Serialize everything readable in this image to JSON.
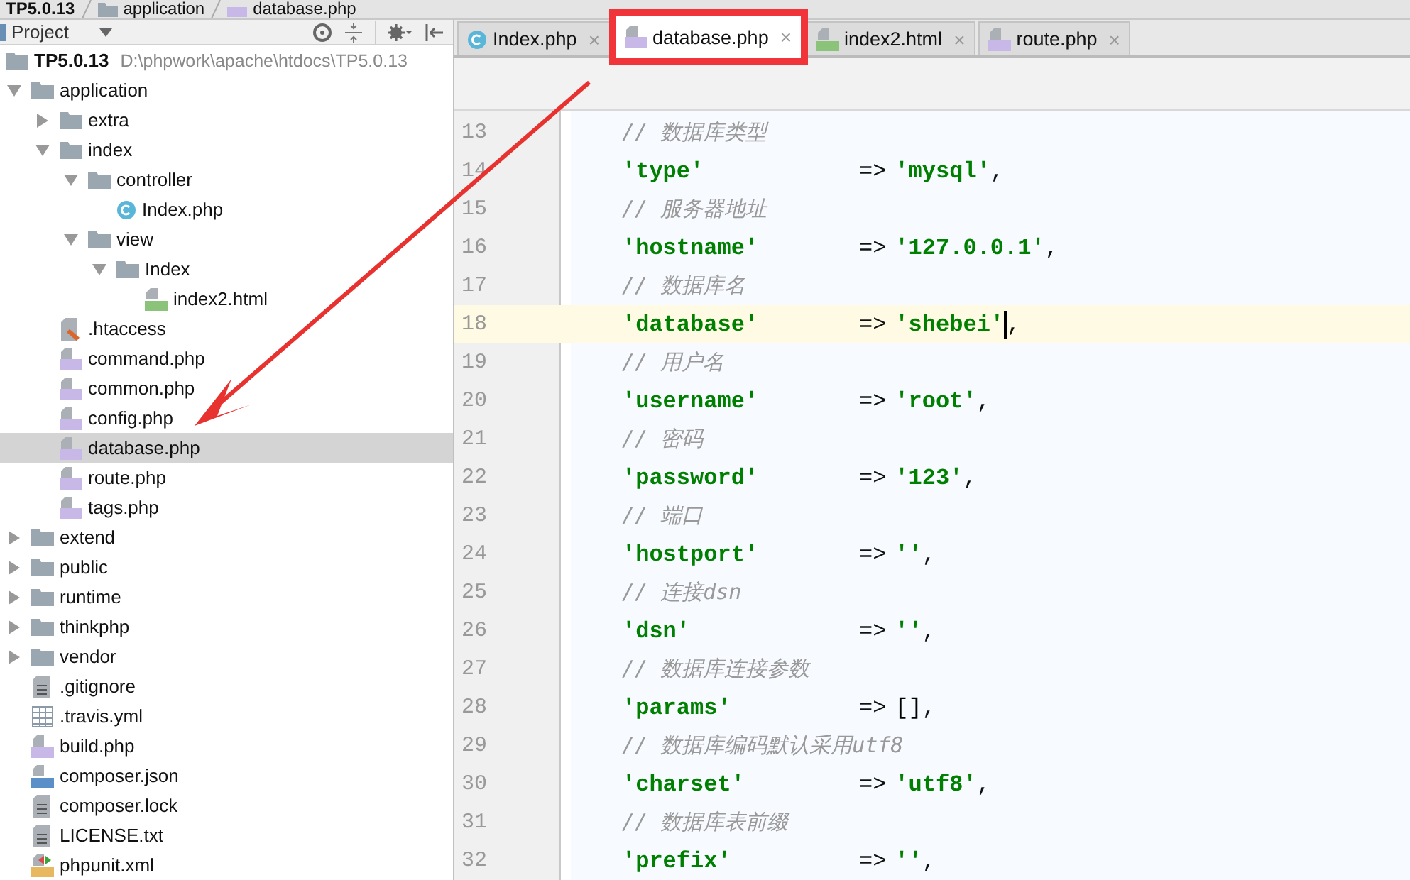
{
  "breadcrumb": [
    {
      "label": "TP5.0.13",
      "kind": "project"
    },
    {
      "label": "application",
      "kind": "folder"
    },
    {
      "label": "database.php",
      "kind": "php"
    }
  ],
  "project_panel": {
    "title": "Project"
  },
  "tree": [
    {
      "label": "TP5.0.13",
      "kind": "project",
      "path": "D:\\phpwork\\apache\\htdocs\\TP5.0.13",
      "selected": false,
      "children": [
        {
          "label": "application",
          "kind": "folder",
          "selected": false,
          "expanded": true,
          "children": [
            {
              "label": "extra",
              "kind": "folder",
              "selected": false,
              "expanded": false
            },
            {
              "label": "index",
              "kind": "folder",
              "selected": false,
              "expanded": true,
              "children": [
                {
                  "label": "controller",
                  "kind": "folder",
                  "selected": false,
                  "expanded": true,
                  "children": [
                    {
                      "label": "Index.php",
                      "kind": "class",
                      "selected": false
                    }
                  ]
                },
                {
                  "label": "view",
                  "kind": "folder",
                  "selected": false,
                  "expanded": true,
                  "children": [
                    {
                      "label": "Index",
                      "kind": "folder",
                      "selected": false,
                      "expanded": true,
                      "children": [
                        {
                          "label": "index2.html",
                          "kind": "html",
                          "selected": false
                        }
                      ]
                    }
                  ]
                }
              ]
            },
            {
              "label": ".htaccess",
              "kind": "htaccess",
              "selected": false
            },
            {
              "label": "command.php",
              "kind": "php",
              "selected": false
            },
            {
              "label": "common.php",
              "kind": "php",
              "selected": false
            },
            {
              "label": "config.php",
              "kind": "php",
              "selected": false
            },
            {
              "label": "database.php",
              "kind": "php",
              "selected": true
            },
            {
              "label": "route.php",
              "kind": "php",
              "selected": false
            },
            {
              "label": "tags.php",
              "kind": "php",
              "selected": false
            }
          ]
        },
        {
          "label": "extend",
          "kind": "folder",
          "selected": false,
          "expanded": false
        },
        {
          "label": "public",
          "kind": "folder",
          "selected": false,
          "expanded": false
        },
        {
          "label": "runtime",
          "kind": "folder",
          "selected": false,
          "expanded": false
        },
        {
          "label": "thinkphp",
          "kind": "folder",
          "selected": false,
          "expanded": false
        },
        {
          "label": "vendor",
          "kind": "folder",
          "selected": false,
          "expanded": false
        },
        {
          "label": ".gitignore",
          "kind": "text",
          "selected": false
        },
        {
          "label": ".travis.yml",
          "kind": "yml",
          "selected": false
        },
        {
          "label": "build.php",
          "kind": "php",
          "selected": false
        },
        {
          "label": "composer.json",
          "kind": "json",
          "selected": false
        },
        {
          "label": "composer.lock",
          "kind": "text",
          "selected": false
        },
        {
          "label": "LICENSE.txt",
          "kind": "text",
          "selected": false
        },
        {
          "label": "phpunit.xml",
          "kind": "xml",
          "selected": false
        }
      ]
    }
  ],
  "tabs": [
    {
      "label": "Index.php",
      "kind": "class",
      "selected": false,
      "highlighted": false
    },
    {
      "label": "database.php",
      "kind": "php",
      "selected": true,
      "highlighted": true
    },
    {
      "label": "index2.html",
      "kind": "html",
      "selected": false,
      "highlighted": false
    },
    {
      "label": "route.php",
      "kind": "php",
      "selected": false,
      "highlighted": false
    }
  ],
  "tab_close": "×",
  "code_lines": [
    {
      "number": "13",
      "kind": "comment",
      "text": "// 数据库类型",
      "current": false
    },
    {
      "number": "14",
      "kind": "entry",
      "key": "'type'",
      "op": "=>",
      "value": {
        "text": "'mysql'",
        "kind": "string"
      },
      "punct": ",",
      "current": false
    },
    {
      "number": "15",
      "kind": "comment",
      "text": "// 服务器地址",
      "current": false
    },
    {
      "number": "16",
      "kind": "entry",
      "key": "'hostname'",
      "op": "=>",
      "value": {
        "text": "'127.0.0.1'",
        "kind": "string"
      },
      "punct": ",",
      "current": false
    },
    {
      "number": "17",
      "kind": "comment",
      "text": "// 数据库名",
      "current": false
    },
    {
      "number": "18",
      "kind": "entry",
      "key": "'database'",
      "op": "=>",
      "value": {
        "text": "'shebei'",
        "kind": "string"
      },
      "punct": ",",
      "current": true
    },
    {
      "number": "19",
      "kind": "comment",
      "text": "// 用户名",
      "current": false
    },
    {
      "number": "20",
      "kind": "entry",
      "key": "'username'",
      "op": "=>",
      "value": {
        "text": "'root'",
        "kind": "string"
      },
      "punct": ",",
      "current": false
    },
    {
      "number": "21",
      "kind": "comment",
      "text": "// 密码",
      "current": false
    },
    {
      "number": "22",
      "kind": "entry",
      "key": "'password'",
      "op": "=>",
      "value": {
        "text": "'123'",
        "kind": "string"
      },
      "punct": ",",
      "current": false
    },
    {
      "number": "23",
      "kind": "comment",
      "text": "// 端口",
      "current": false
    },
    {
      "number": "24",
      "kind": "entry",
      "key": "'hostport'",
      "op": "=>",
      "value": {
        "text": "''",
        "kind": "string"
      },
      "punct": ",",
      "current": false
    },
    {
      "number": "25",
      "kind": "comment",
      "text": "// 连接dsn",
      "current": false
    },
    {
      "number": "26",
      "kind": "entry",
      "key": "'dsn'",
      "op": "=>",
      "value": {
        "text": "''",
        "kind": "string"
      },
      "punct": ",",
      "current": false
    },
    {
      "number": "27",
      "kind": "comment",
      "text": "// 数据库连接参数",
      "current": false
    },
    {
      "number": "28",
      "kind": "entry",
      "key": "'params'",
      "op": "=>",
      "value": {
        "text": "[]",
        "kind": "array"
      },
      "punct": ",",
      "current": false
    },
    {
      "number": "29",
      "kind": "comment",
      "text": "// 数据库编码默认采用utf8",
      "current": false
    },
    {
      "number": "30",
      "kind": "entry",
      "key": "'charset'",
      "op": "=>",
      "value": {
        "text": "'utf8'",
        "kind": "string"
      },
      "punct": ",",
      "current": false
    },
    {
      "number": "31",
      "kind": "comment",
      "text": "// 数据库表前缀",
      "current": false
    },
    {
      "number": "32",
      "kind": "entry",
      "key": "'prefix'",
      "op": "=>",
      "value": {
        "text": "''",
        "kind": "string"
      },
      "punct": ",",
      "current": false
    }
  ]
}
